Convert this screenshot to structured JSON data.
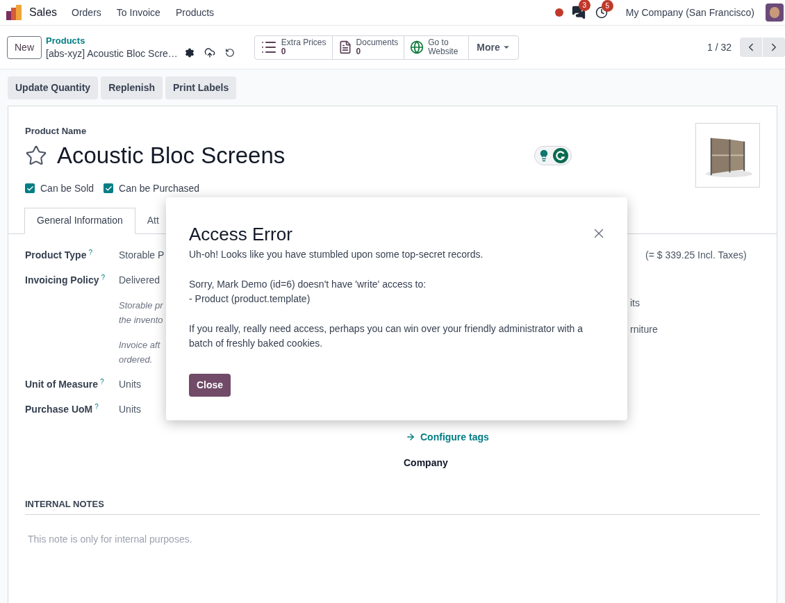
{
  "navbar": {
    "app": "Sales",
    "menu": [
      "Orders",
      "To Invoice",
      "Products"
    ],
    "chat_count": "3",
    "activity_count": "5",
    "company": "My Company (San Francisco)"
  },
  "control_panel": {
    "new_button": "New",
    "breadcrumb": "Products",
    "record": "[abs-xyz] Acoustic Bloc Scre…",
    "smart_buttons": [
      {
        "kind": "list",
        "label": "Extra Prices",
        "value": "0"
      },
      {
        "kind": "document",
        "label": "Documents",
        "value": "0"
      },
      {
        "kind": "globe",
        "label": "Go to Website"
      },
      {
        "kind": "dropdown",
        "label": "More"
      }
    ],
    "pager": "1 / 32"
  },
  "actions": [
    "Update Quantity",
    "Replenish",
    "Print Labels"
  ],
  "form": {
    "name_label": "Product Name",
    "title": "Acoustic Bloc Screens",
    "starred": false,
    "checkboxes": [
      {
        "label": "Can be Sold",
        "checked": true
      },
      {
        "label": "Can be Purchased",
        "checked": true
      }
    ],
    "tabs": [
      {
        "label": "General Information",
        "selected": true
      },
      {
        "label": "Att",
        "selected": false
      }
    ],
    "fields": [
      {
        "label": "Product Type",
        "help": "?",
        "value": "Storable P"
      },
      {
        "label": "Invoicing Policy",
        "help": "?",
        "value": "Delivered",
        "notes": [
          [
            "Storable pr",
            "the invento"
          ],
          [
            "Invoice aft",
            "ordered."
          ]
        ]
      },
      {
        "label": "Unit of Measure",
        "help": "?",
        "value": "Units"
      },
      {
        "label": "Purchase UoM",
        "help": "?",
        "value": "Units"
      }
    ],
    "price_note": "(= $ 339.25 Incl. Taxes)",
    "right_fragments": [
      "its",
      "rniture"
    ],
    "configure_tags": "Configure tags",
    "company_label": "Company",
    "notes_heading": "INTERNAL NOTES",
    "notes_placeholder": "This note is only for internal purposes."
  },
  "dialog": {
    "title": "Access Error",
    "paragraphs": [
      [
        "Uh-oh! Looks like you have stumbled upon some top-secret records."
      ],
      [
        "Sorry, Mark Demo (id=6) doesn't have 'write' access to:",
        "- Product (product.template)"
      ],
      [
        "If you really, really need access, perhaps you can win over your friendly administrator with a",
        "batch of freshly baked cookies."
      ]
    ],
    "close_button": "Close"
  }
}
